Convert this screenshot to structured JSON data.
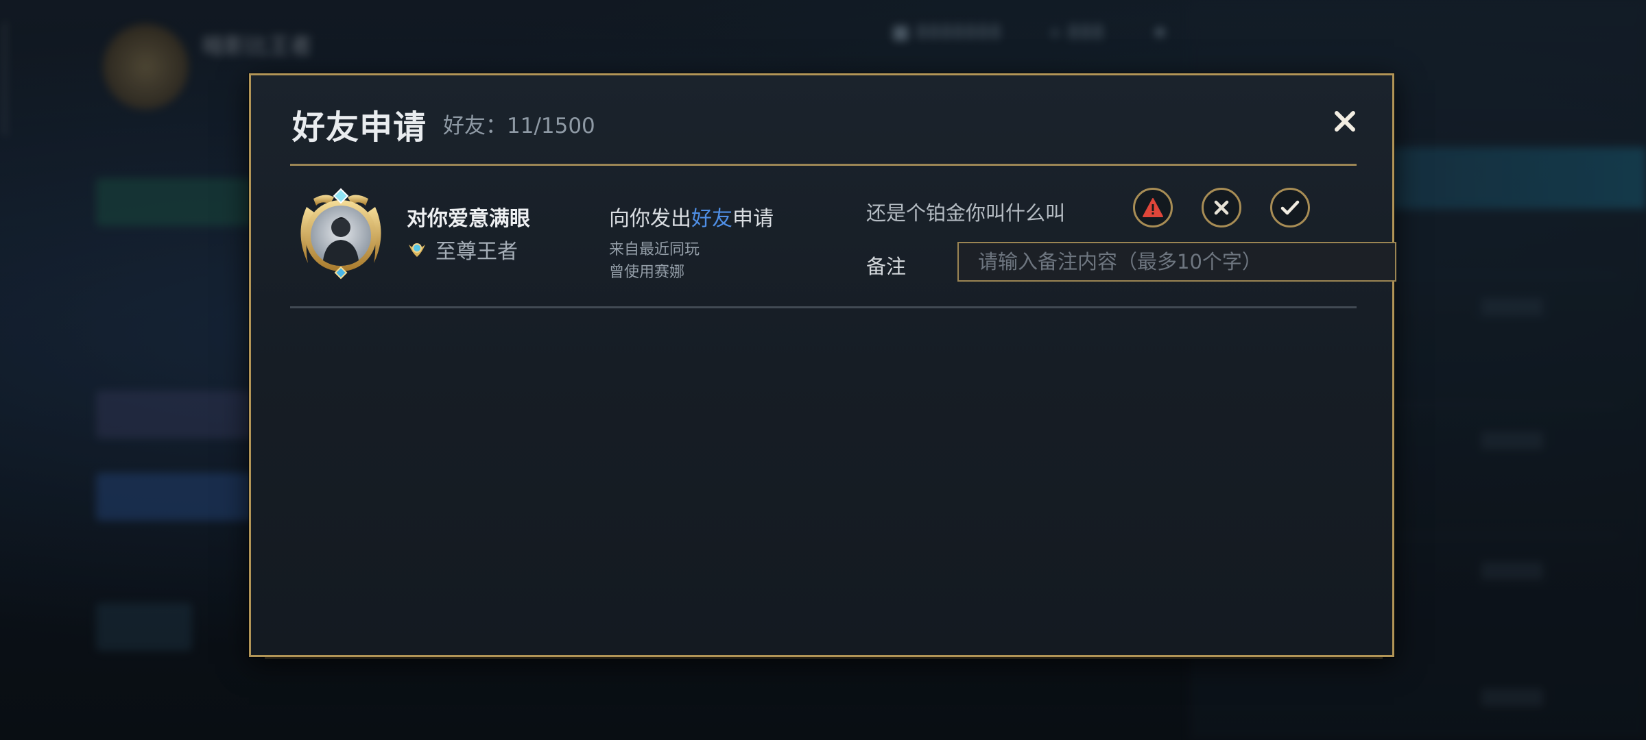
{
  "background": {
    "player_name_blurred": "暗影比王者",
    "topbar_items": [
      "■ 8888888",
      "⟡ 888",
      "★"
    ]
  },
  "dialog": {
    "title": "好友申请",
    "friend_count": "好友：11/1500",
    "request": {
      "player_name": "对你爱意满眼",
      "rank": "至尊王者",
      "request_prefix": "向你发出",
      "request_highlight": "好友",
      "request_suffix": "申请",
      "source": "来自最近同玩",
      "hero_used": "曾使用赛娜",
      "message": "还是个铂金你叫什么叫",
      "remark_label": "备注",
      "remark_placeholder": "请输入备注内容（最多10个字）",
      "remark_value": ""
    }
  },
  "colors": {
    "gold_border": "#b29557",
    "highlight_blue": "#4f8fe6",
    "report_red": "#e0463a",
    "dialog_bg": "#1b232c"
  },
  "icons": {
    "close": "close-icon",
    "report": "warning-icon",
    "reject": "x-circle-icon",
    "accept": "check-circle-icon"
  }
}
